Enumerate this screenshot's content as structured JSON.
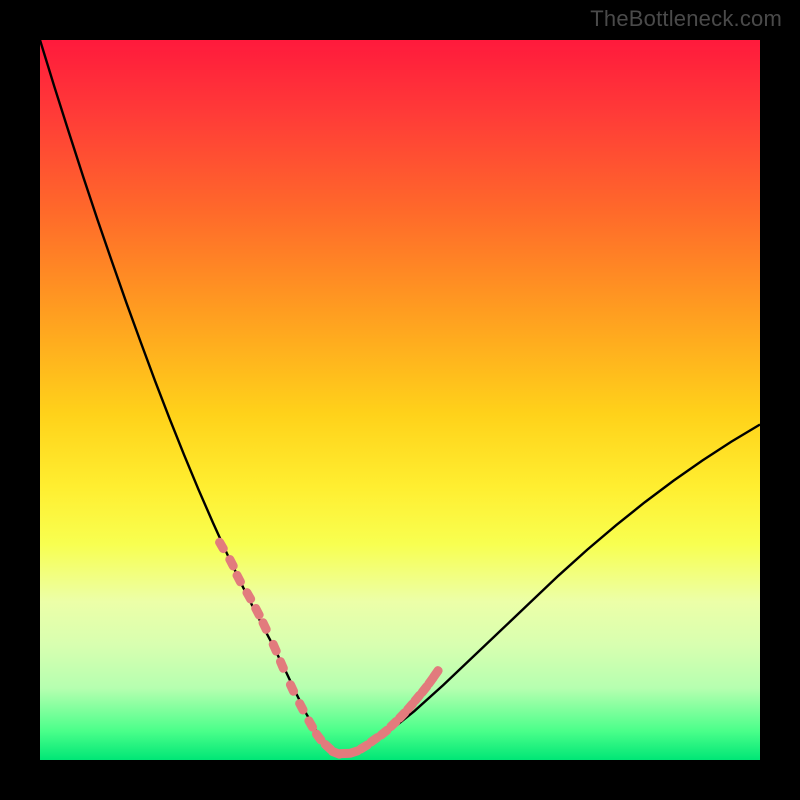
{
  "watermark": "TheBottleneck.com",
  "colors": {
    "background": "#000000",
    "curve": "#000000",
    "markers": "#e27b7d",
    "gradient_top": "#ff1a3c",
    "gradient_bottom": "#00e676"
  },
  "chart_data": {
    "type": "line",
    "title": "",
    "xlabel": "",
    "ylabel": "",
    "x_range": [
      0,
      100
    ],
    "y_range": [
      0,
      100
    ],
    "curve": {
      "name": "bottleneck-curve",
      "x": [
        0,
        2,
        4,
        6,
        8,
        10,
        12,
        14,
        16,
        18,
        20,
        22,
        24,
        26,
        28,
        30,
        32,
        34,
        35.5,
        37,
        38.5,
        40,
        42,
        44,
        48,
        52,
        56,
        60,
        64,
        68,
        72,
        76,
        80,
        84,
        88,
        92,
        96,
        100
      ],
      "y": [
        100,
        93.5,
        87.2,
        81.0,
        75.0,
        69.2,
        63.5,
        58.0,
        52.6,
        47.4,
        42.4,
        37.6,
        33.0,
        28.6,
        24.4,
        20.4,
        16.6,
        12.6,
        9.4,
        6.4,
        3.8,
        1.8,
        0.8,
        1.2,
        3.6,
        6.8,
        10.4,
        14.2,
        18.0,
        21.8,
        25.6,
        29.2,
        32.6,
        35.8,
        38.8,
        41.6,
        44.2,
        46.6
      ]
    },
    "markers": {
      "name": "highlighted-points",
      "note": "dashed/elongated markers along band near curve bottom",
      "x": [
        25.2,
        26.6,
        27.6,
        29.0,
        30.2,
        31.2,
        32.6,
        33.6,
        35.0,
        36.3,
        37.6,
        38.7,
        40.0,
        41.1,
        42.3,
        43.6,
        45.0,
        46.4,
        47.8,
        49.1,
        50.3,
        51.4,
        52.4,
        53.4,
        54.3,
        55.0
      ],
      "y": [
        29.8,
        27.4,
        25.2,
        22.8,
        20.6,
        18.6,
        15.6,
        13.2,
        10.0,
        7.4,
        5.0,
        3.2,
        1.8,
        1.0,
        0.9,
        1.1,
        1.8,
        2.8,
        3.8,
        5.0,
        6.2,
        7.4,
        8.6,
        9.8,
        11.0,
        12.0
      ]
    }
  }
}
